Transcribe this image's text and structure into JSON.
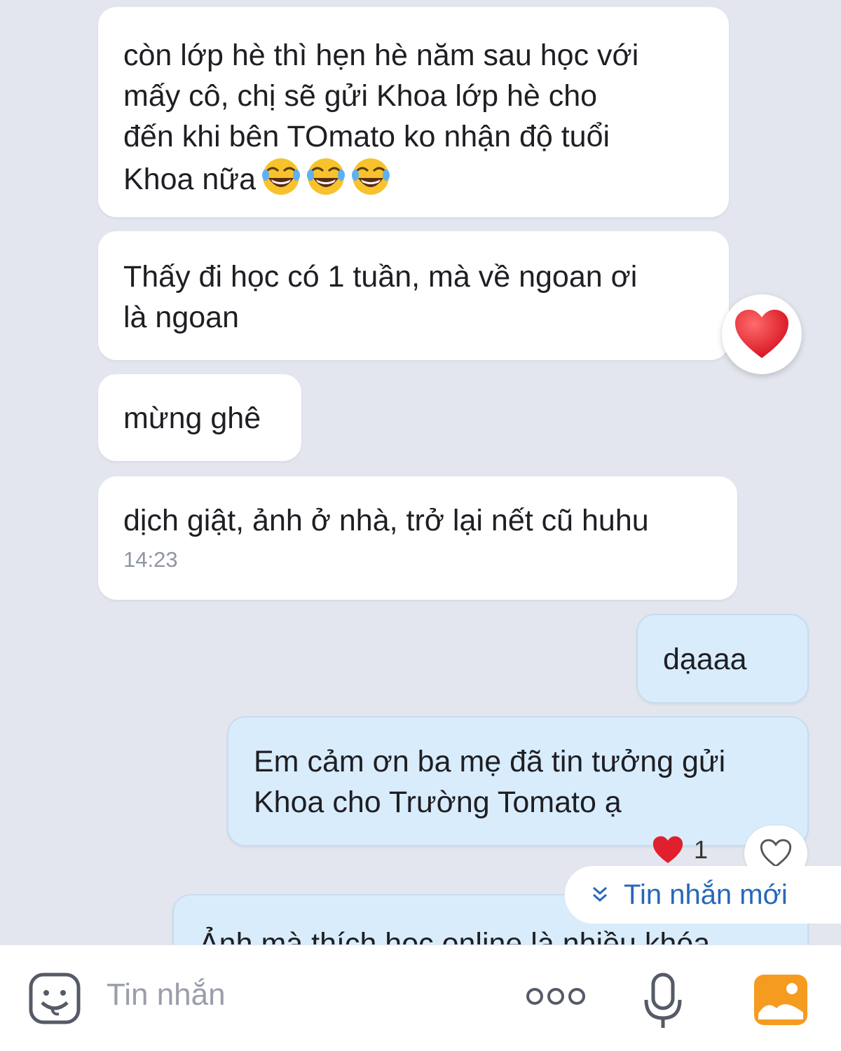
{
  "messages": {
    "m1": {
      "lines": [
        "còn lớp hè thì hẹn hè năm sau học với",
        "mấy cô, chị sẽ gửi Khoa lớp hè cho",
        "đến khi bên TOmato ko nhận độ tuổi",
        "Khoa nữa"
      ],
      "emoji": "😂😂😂"
    },
    "m2": {
      "lines": [
        "Thấy đi học có 1 tuần, mà về ngoan ơi",
        "là ngoan"
      ],
      "reaction": "heart"
    },
    "m3": {
      "lines": [
        "mừng ghê"
      ]
    },
    "m4": {
      "lines": [
        "dịch giật, ảnh ở nhà, trở lại nết cũ huhu"
      ],
      "time": "14:23"
    },
    "m5": {
      "lines": [
        "dạaaa"
      ]
    },
    "m6": {
      "lines": [
        "Em cảm ơn ba mẹ đã tin tưởng gửi",
        "Khoa cho Trường Tomato ạ"
      ],
      "reaction_count": "1"
    },
    "m7": {
      "lines": [
        "Ảnh mà thích học online là nhiều khóa"
      ]
    }
  },
  "new_message_label": "Tin nhắn mới",
  "composer": {
    "placeholder": "Tin nhắn"
  },
  "colors": {
    "heart": "#e0202e",
    "link": "#2767b8",
    "outgoing": "#d9ecfb",
    "photo_icon": "#f59b1f"
  },
  "icons": [
    "laughing-emoji-icon",
    "heart-icon",
    "heart-outline-icon",
    "chevron-double-down-icon",
    "sticker-icon",
    "more-icon",
    "microphone-icon",
    "photo-icon"
  ]
}
